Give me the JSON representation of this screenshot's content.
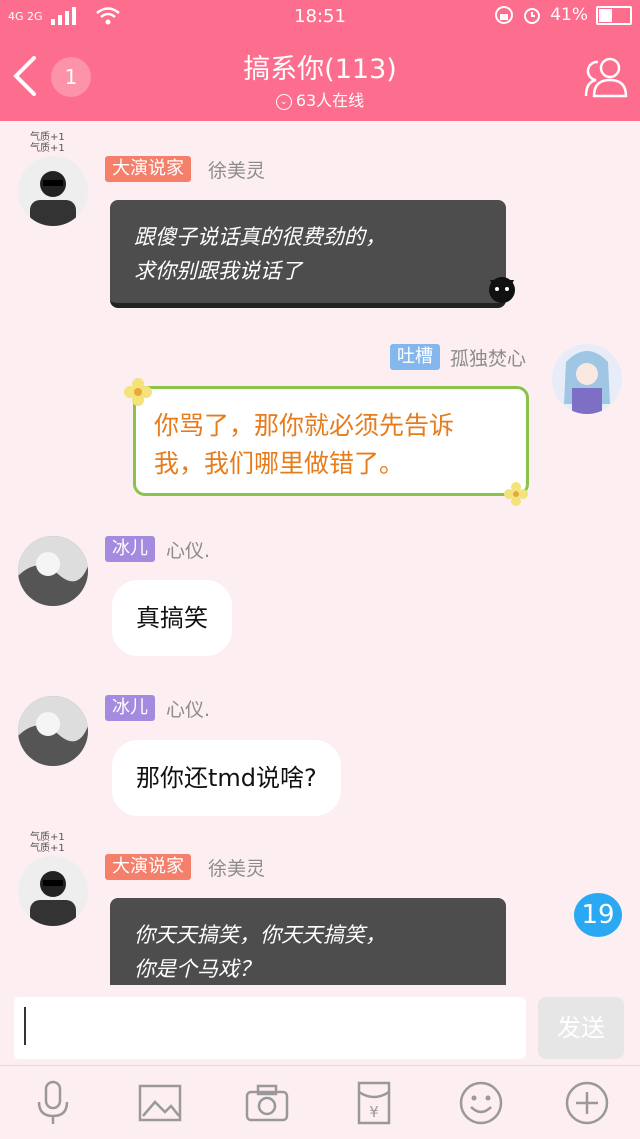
{
  "status_bar": {
    "network": "4G 2G",
    "time": "18:51",
    "battery_text": "41%",
    "battery_level": 0.41
  },
  "header": {
    "back_badge": "1",
    "title": "搞系你(113)",
    "online": "63人在线"
  },
  "messages": [
    {
      "tag": "大演说家",
      "tag_color": "#f47f6b",
      "nick": "徐美灵",
      "line1": "跟傻子说话真的很费劲的，",
      "line2": "求你别跟我说话了"
    },
    {
      "tag": "吐槽",
      "tag_color": "#85b7ef",
      "nick": "孤独焚心",
      "line1": "你骂了，那你就必须先告诉",
      "line2": "我，我们哪里做错了。"
    },
    {
      "tag": "冰儿",
      "tag_color": "#a58be0",
      "nick": "心仪.",
      "text": "真搞笑"
    },
    {
      "tag": "冰儿",
      "tag_color": "#a58be0",
      "nick": "心仪.",
      "text": "那你还tmd说啥?"
    },
    {
      "tag": "大演说家",
      "tag_color": "#f47f6b",
      "nick": "徐美灵",
      "line1": "你天天搞笑，你天天搞笑，",
      "line2": "你是个马戏？"
    }
  ],
  "avatar_caption_1": "气质+1",
  "avatar_caption_2": "气质+1",
  "new_messages": "19",
  "composer": {
    "value": "",
    "send_label": "发送"
  },
  "toolbar": [
    "mic-icon",
    "image-icon",
    "camera-icon",
    "red-packet-icon",
    "emoji-icon",
    "plus-icon"
  ]
}
